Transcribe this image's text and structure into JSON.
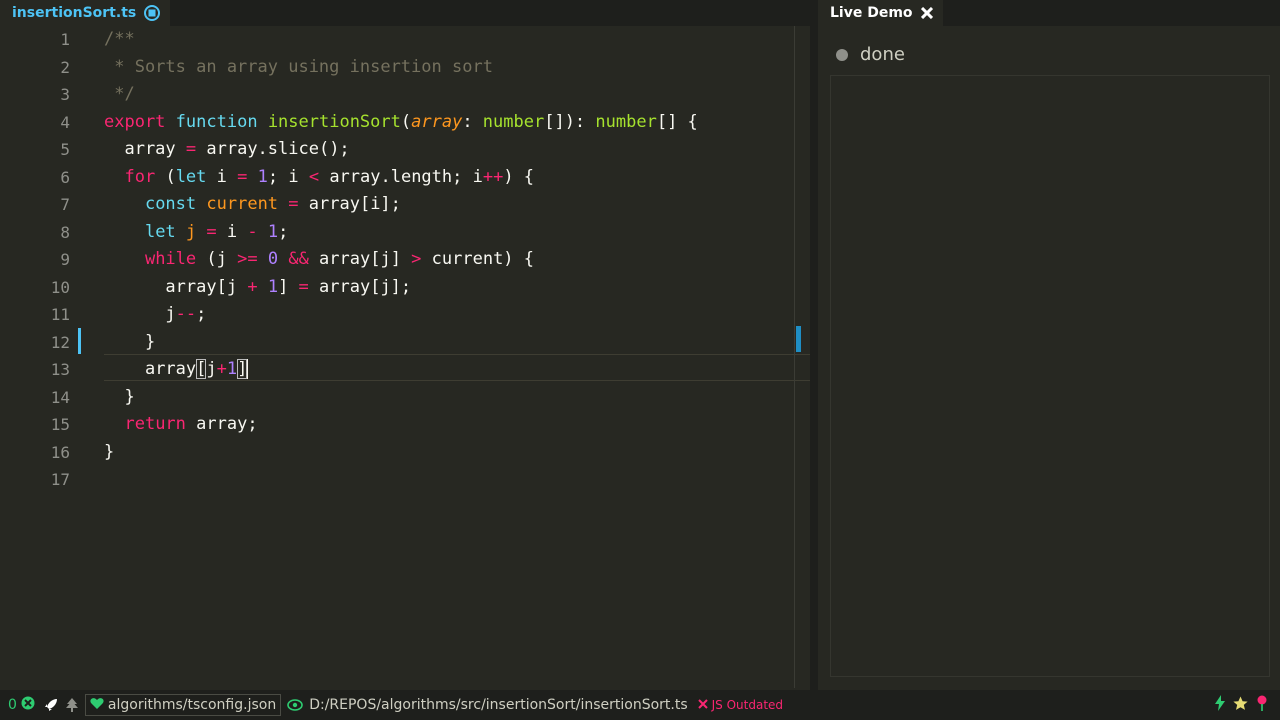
{
  "editor_tab": {
    "label": "insertionSort.ts"
  },
  "demo_tab": {
    "label": "Live Demo"
  },
  "code": {
    "line_numbers": [
      "1",
      "2",
      "3",
      "4",
      "5",
      "6",
      "7",
      "8",
      "9",
      "10",
      "11",
      "12",
      "13",
      "14",
      "15",
      "16",
      "17"
    ],
    "line1": {
      "comment": "/**"
    },
    "line2": {
      "comment": " * Sorts an array using insertion sort"
    },
    "line3": {
      "comment": " */"
    },
    "line4": {
      "kw_export": "export",
      "kw_function": "function",
      "fn_name": "insertionSort",
      "open": "(",
      "param": "array",
      "colon": ": ",
      "type1": "number",
      "type1_suffix": "[]): ",
      "type2": "number",
      "tail": "[] {"
    },
    "line5": {
      "text": "  array = array.slice();",
      "lhs": "  array ",
      "op": "=",
      "rhs": " array.slice();"
    },
    "line6": {
      "kw_for": "for",
      "paren": " (",
      "kw_let": "let",
      "var": " i ",
      "eq": "=",
      "sp": " ",
      "num": "1",
      "mid": "; i ",
      "lt": "<",
      "mid2": " array.length; i",
      "inc": "++",
      "tail": ") {"
    },
    "line7": {
      "kw_const": "const",
      "var": "current",
      "sp1": " ",
      "eq": "=",
      "tail": " array[i];"
    },
    "line8": {
      "kw_let": "let",
      "var": "j",
      "eq": "=",
      "mid": " i ",
      "minus": "-",
      "num": "1",
      "tail": ";"
    },
    "line9": {
      "kw_while": "while",
      "p1": " (j ",
      "ge": ">=",
      "sp": " ",
      "zero": "0",
      "and": "&&",
      "mid": " array[j] ",
      "gt": ">",
      "tail": " current) {"
    },
    "line10": {
      "a": "array[j ",
      "plus": "+",
      "one": "1",
      "b": "] ",
      "eq": "=",
      "c": " array[j];"
    },
    "line11": {
      "a": "j",
      "dec": "--",
      "b": ";"
    },
    "line12": {
      "text": "}"
    },
    "line13": {
      "a": "array",
      "lb": "[",
      "j": "j",
      "plus": "+",
      "one": "1",
      "rb": "]"
    },
    "line14": {
      "text": "}"
    },
    "line15": {
      "kw_return": "return",
      "tail": " array;"
    },
    "line16": {
      "text": "}"
    }
  },
  "demo": {
    "status": "done"
  },
  "statusbar": {
    "error_count": "0",
    "tsconfig": "algorithms/tsconfig.json",
    "file_path": "D:/REPOS/algorithms/src/insertionSort/insertionSort.ts",
    "js_status": "JS Outdated"
  },
  "colors": {
    "background": "#272822",
    "keyword": "#f92672",
    "storage": "#66d9ef",
    "function": "#a6e22e",
    "parameter": "#fd971f",
    "number": "#ae81ff",
    "comment": "#75715e",
    "accent_blue": "#4dc3f5",
    "status_error": "#f92672",
    "status_ok": "#2ecc71"
  }
}
